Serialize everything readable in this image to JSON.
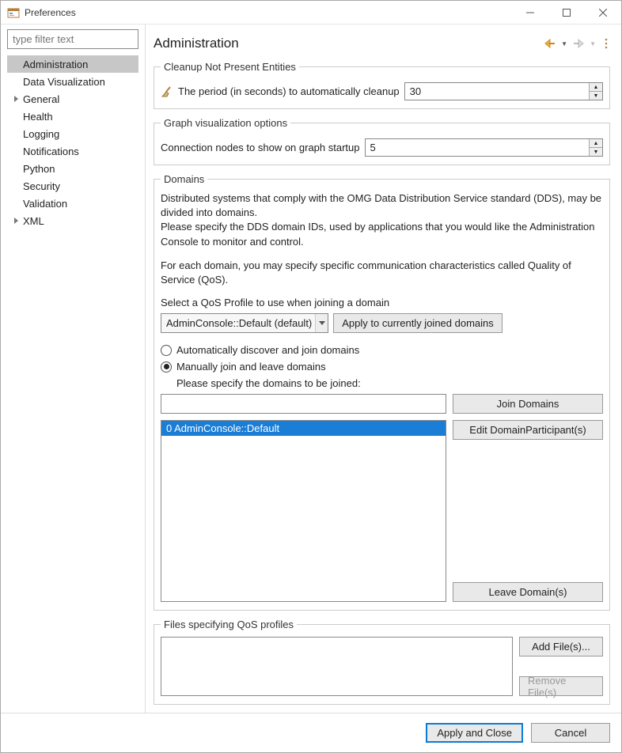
{
  "window": {
    "title": "Preferences"
  },
  "sidebar": {
    "filter_placeholder": "type filter text",
    "items": [
      {
        "label": "Administration",
        "selected": true,
        "expandable": false
      },
      {
        "label": "Data Visualization",
        "selected": false,
        "expandable": false
      },
      {
        "label": "General",
        "selected": false,
        "expandable": true
      },
      {
        "label": "Health",
        "selected": false,
        "expandable": false
      },
      {
        "label": "Logging",
        "selected": false,
        "expandable": false
      },
      {
        "label": "Notifications",
        "selected": false,
        "expandable": false
      },
      {
        "label": "Python",
        "selected": false,
        "expandable": false
      },
      {
        "label": "Security",
        "selected": false,
        "expandable": false
      },
      {
        "label": "Validation",
        "selected": false,
        "expandable": false
      },
      {
        "label": "XML",
        "selected": false,
        "expandable": true
      }
    ]
  },
  "page": {
    "title": "Administration",
    "cleanup": {
      "legend": "Cleanup Not Present Entities",
      "label": "The period (in seconds) to automatically cleanup",
      "value": "30"
    },
    "graph": {
      "legend": "Graph visualization options",
      "label": "Connection nodes to show on graph startup",
      "value": "5"
    },
    "domains": {
      "legend": "Domains",
      "desc1": "Distributed systems that comply with the OMG Data Distribution Service standard (DDS), may be divided into domains.",
      "desc2": "Please specify the DDS domain IDs, used by applications that you would like the Administration Console to monitor and control.",
      "desc3": "For each domain, you may specify specific communication characteristics called Quality of Service (QoS).",
      "select_label": "Select a QoS Profile to use when joining a domain",
      "combo_value": "AdminConsole::Default (default)",
      "apply_btn": "Apply to currently joined domains",
      "radio_auto": "Automatically discover and join domains",
      "radio_manual": "Manually join and leave domains",
      "specify_label": "Please specify the domains to be joined:",
      "domain_input": "",
      "join_btn": "Join Domains",
      "edit_btn": "Edit DomainParticipant(s)",
      "leave_btn": "Leave Domain(s)",
      "list": [
        "0 AdminConsole::Default"
      ]
    },
    "qos": {
      "legend": "Files specifying QoS profiles",
      "add_btn": "Add File(s)...",
      "remove_btn": "Remove File(s)"
    }
  },
  "footer": {
    "apply": "Apply and Close",
    "cancel": "Cancel"
  }
}
